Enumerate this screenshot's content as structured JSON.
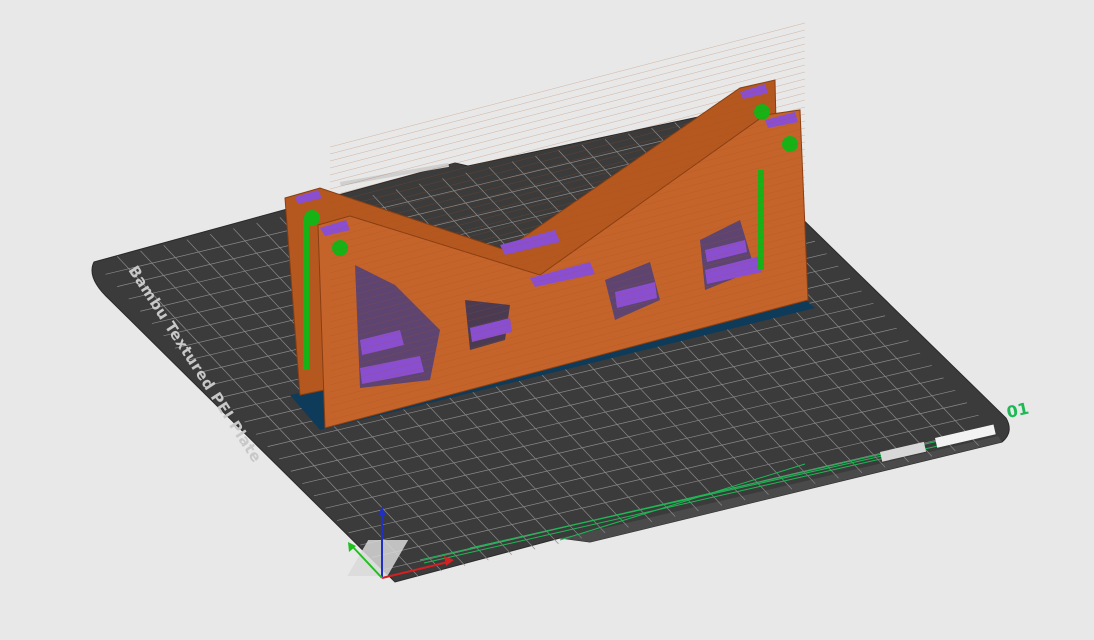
{
  "viewport": {
    "background_color": "#e8e8e8"
  },
  "plate": {
    "label": "Bambu Textured PEI Plate",
    "number": "01",
    "surface_color": "#3d3d3d",
    "grid_color": "#8a8a8a",
    "number_color": "#1db954"
  },
  "model": {
    "wall_color": "#c0622a",
    "infill_color": "#8a4fd0",
    "support_color": "#16b316",
    "brim_color": "#0e3b5a"
  },
  "axes": {
    "x_color": "#d32020",
    "y_color": "#20c020",
    "z_color": "#2030c0"
  }
}
